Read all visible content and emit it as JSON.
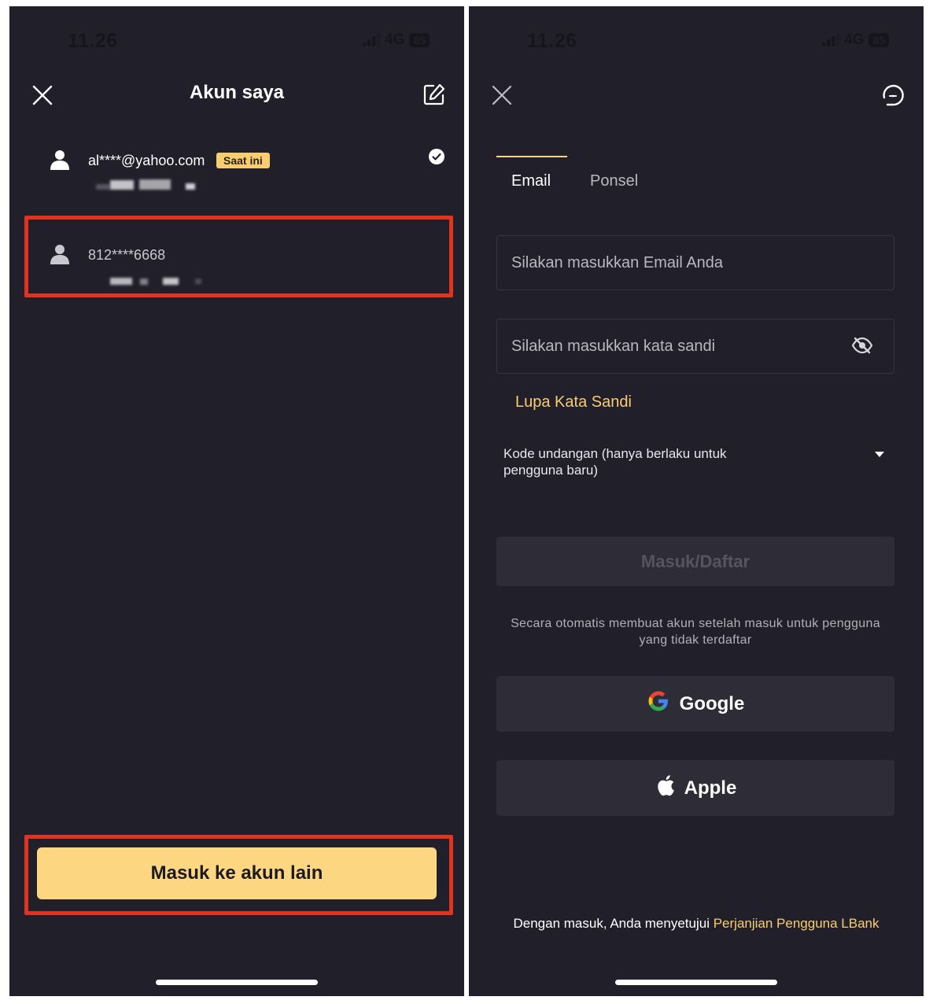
{
  "left": {
    "status": {
      "time": "11.26",
      "network": "4G",
      "battery": "85"
    },
    "header": {
      "title": "Akun saya"
    },
    "accounts": [
      {
        "name": "al****@yahoo.com",
        "badge": "Saat ini",
        "selected": true
      },
      {
        "name": "812****6668",
        "selected": false
      }
    ],
    "primary_button": "Masuk ke akun lain"
  },
  "right": {
    "status": {
      "time": "11.26",
      "network": "4G",
      "battery": "85"
    },
    "tabs": [
      {
        "label": "Email",
        "active": true
      },
      {
        "label": "Ponsel",
        "active": false
      }
    ],
    "email_placeholder": "Silakan masukkan Email Anda",
    "password_placeholder": "Silakan masukkan kata sandi",
    "forgot_link": "Lupa Kata Sandi",
    "invite_label": "Kode undangan (hanya berlaku untuk pengguna baru)",
    "submit_button": "Masuk/Daftar",
    "auto_note": "Secara otomatis membuat akun setelah masuk untuk pengguna yang tidak terdaftar",
    "google_button": "Google",
    "apple_button": "Apple",
    "terms_prefix": "Dengan masuk, Anda menyetujui",
    "terms_link": "Perjanjian Pengguna LBank"
  },
  "colors": {
    "background": "#211f2a",
    "accent": "#f9cd70",
    "highlight": "#e2331f",
    "button_primary": "#fcd681"
  },
  "icons": [
    "close-icon",
    "edit-icon",
    "user-icon",
    "check-circle-icon",
    "support-icon",
    "eye-off-icon",
    "google-icon",
    "apple-icon",
    "dropdown-caret-icon"
  ]
}
